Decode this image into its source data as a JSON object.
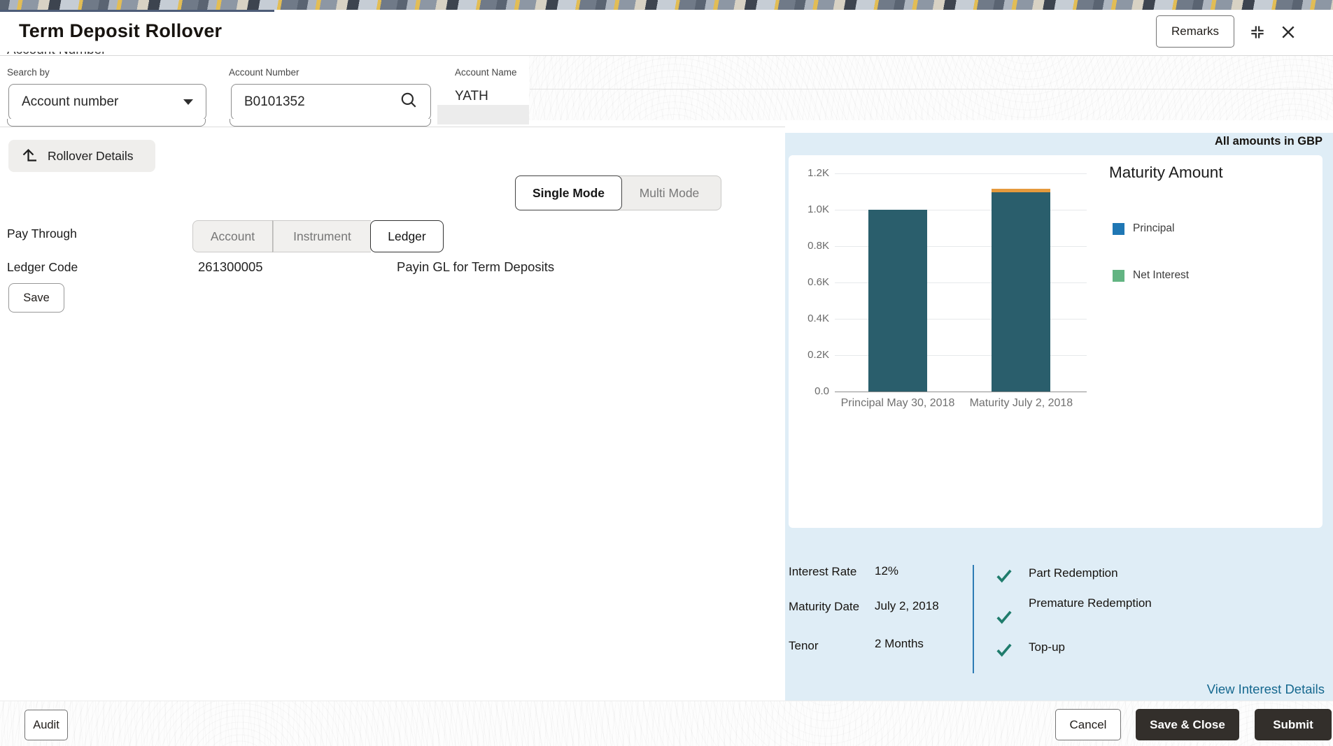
{
  "header": {
    "title": "Term Deposit Rollover",
    "remarks_label": "Remarks"
  },
  "search": {
    "search_by_label": "Search by",
    "search_by_value": "Account number",
    "account_number_label": "Account Number",
    "account_number_value": "B0101352",
    "account_name_label": "Account Name",
    "account_name_value": "YATH",
    "ghost_label": "Account Number"
  },
  "toolbar": {
    "rollover_details_label": "Rollover Details",
    "save_label": "Save"
  },
  "mode": {
    "single_label": "Single Mode",
    "multi_label": "Multi Mode"
  },
  "pay_through": {
    "label": "Pay Through",
    "tabs": [
      "Account",
      "Instrument",
      "Ledger"
    ],
    "ledger_code_label": "Ledger Code",
    "ledger_code_value": "261300005",
    "ledger_description": "Payin GL for Term Deposits"
  },
  "summary": {
    "amounts_note": "All amounts in GBP",
    "interest_rate_label": "Interest Rate",
    "interest_rate_value": "12%",
    "maturity_date_label": "Maturity Date",
    "maturity_date_value": "July 2, 2018",
    "tenor_label": "Tenor",
    "tenor_value": "2 Months",
    "flags": [
      "Part Redemption",
      "Premature Redemption",
      "Top-up"
    ],
    "view_link": "View Interest Details",
    "check_color": "#1f7c6c"
  },
  "chart_data": {
    "type": "bar",
    "stacked": true,
    "title": "Maturity Amount",
    "categories": [
      "Principal May 30, 2018",
      "Maturity July 2, 2018"
    ],
    "series": [
      {
        "name": "Principal",
        "legend_color": "#1f77b4",
        "bar_color": "#2a5e6c",
        "values": [
          1000,
          1095
        ]
      },
      {
        "name": "Net Interest",
        "legend_color": "#62b482",
        "bar_color": "#e59a3d",
        "values": [
          0,
          20
        ]
      }
    ],
    "ylim": [
      0,
      1200
    ],
    "ytick_labels": [
      "1.2K",
      "1.0K",
      "0.8K",
      "0.6K",
      "0.4K",
      "0.2K",
      "0.0"
    ],
    "grid": true,
    "legend_position": "right",
    "note": "All amounts in GBP"
  },
  "footer": {
    "audit_label": "Audit",
    "cancel_label": "Cancel",
    "save_close_label": "Save & Close",
    "submit_label": "Submit"
  }
}
